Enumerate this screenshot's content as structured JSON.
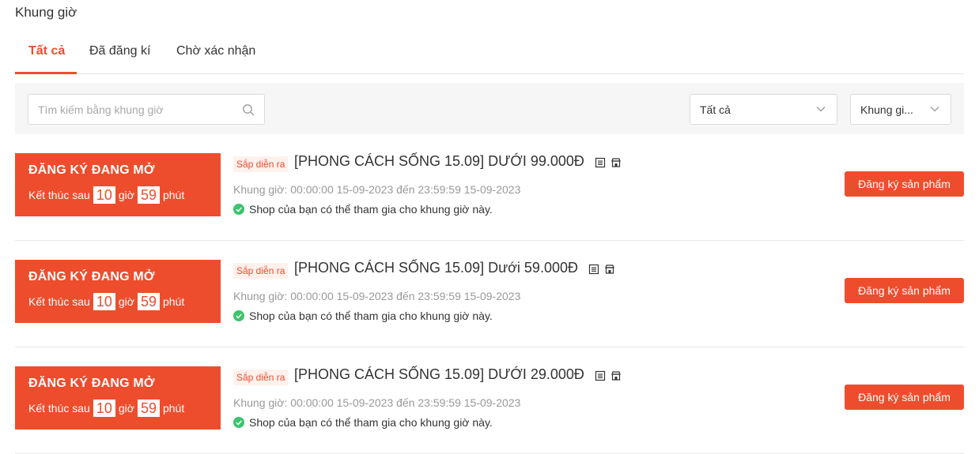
{
  "page_title": "Khung giờ",
  "tabs": [
    {
      "label": "Tất cả",
      "active": true
    },
    {
      "label": "Đã đăng kí",
      "active": false
    },
    {
      "label": "Chờ xác nhận",
      "active": false
    }
  ],
  "filters": {
    "search_placeholder": "Tìm kiếm bằng khung giờ",
    "search_value": "",
    "status_select": "Tất cả",
    "slot_select": "Khung gi..."
  },
  "colors": {
    "accent": "#ee4d2d",
    "success": "#3cc36e"
  },
  "slots": [
    {
      "banner_title": "ĐĂNG KÝ ĐANG MỞ",
      "countdown_prefix": "Kết thúc sau",
      "hours": "10",
      "hours_unit": "giờ",
      "minutes": "59",
      "minutes_unit": "phút",
      "status": "Sắp diễn ra",
      "name": "[PHONG CÁCH SỐNG 15.09] DƯỚI 99.000Đ",
      "time": "Khung giờ: 00:00:00 15-09-2023 đến 23:59:59 15-09-2023",
      "eligibility": "Shop của bạn có thể tham gia cho khung giờ này.",
      "button": "Đăng ký sản phẩm"
    },
    {
      "banner_title": "ĐĂNG KÝ ĐANG MỞ",
      "countdown_prefix": "Kết thúc sau",
      "hours": "10",
      "hours_unit": "giờ",
      "minutes": "59",
      "minutes_unit": "phút",
      "status": "Sắp diễn ra",
      "name": "[PHONG CÁCH SỐNG 15.09] Dưới 59.000Đ",
      "time": "Khung giờ: 00:00:00 15-09-2023 đến 23:59:59 15-09-2023",
      "eligibility": "Shop của bạn có thể tham gia cho khung giờ này.",
      "button": "Đăng ký sản phẩm"
    },
    {
      "banner_title": "ĐĂNG KÝ ĐANG MỞ",
      "countdown_prefix": "Kết thúc sau",
      "hours": "10",
      "hours_unit": "giờ",
      "minutes": "59",
      "minutes_unit": "phút",
      "status": "Sắp diễn ra",
      "name": "[PHONG CÁCH SỐNG 15.09] DƯỚI 29.000Đ",
      "time": "Khung giờ: 00:00:00 15-09-2023 đến 23:59:59 15-09-2023",
      "eligibility": "Shop của bạn có thể tham gia cho khung giờ này.",
      "button": "Đăng ký sản phẩm"
    }
  ],
  "icons": {
    "search": "search-icon",
    "chevron": "chevron-down-icon",
    "list": "list-icon",
    "shop": "shop-icon",
    "check": "check-circle-icon"
  }
}
